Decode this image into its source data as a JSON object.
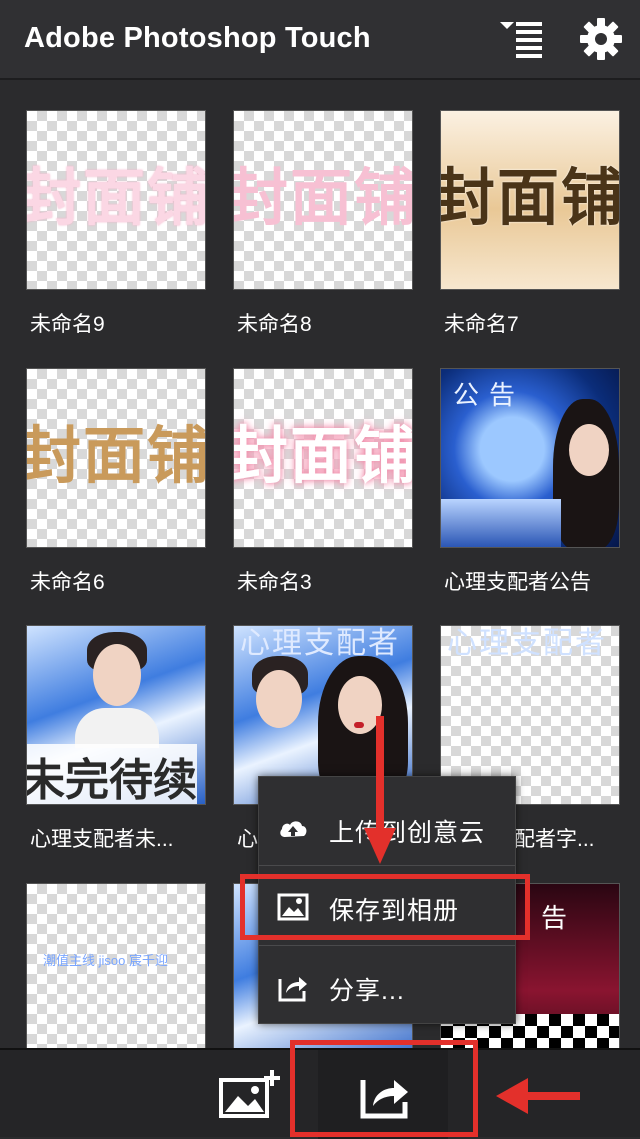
{
  "app": {
    "title": "Adobe Photoshop Touch"
  },
  "colors": {
    "accent_red": "#e3302b",
    "bar_bg": "#303033",
    "grid_bg": "#2b2b2d"
  },
  "grid": {
    "tiles": [
      {
        "label": "未命名9",
        "cover_text": "封面铺"
      },
      {
        "label": "未命名8",
        "cover_text": "封面铺"
      },
      {
        "label": "未命名7",
        "cover_text": "封面铺"
      },
      {
        "label": "未命名6",
        "cover_text": "封面铺"
      },
      {
        "label": "未命名3",
        "cover_text": "封面铺"
      },
      {
        "label": "心理支配者公告",
        "cover_text": "公告"
      },
      {
        "label": "心理支配者未...",
        "cover_text": "未完待续"
      },
      {
        "label": "心",
        "cover_text": "心理支配者"
      },
      {
        "label": "配者字...",
        "cover_text": "心理支配者"
      },
      {
        "label": "",
        "cover_text": "潮值主线 jisoo 宸千迎"
      },
      {
        "label": "",
        "cover_text": ""
      },
      {
        "label": "",
        "cover_text": "告"
      }
    ]
  },
  "popup_menu": {
    "items": [
      {
        "label": "上传到创意云",
        "icon": "cloud-upload-icon"
      },
      {
        "label": "保存到相册",
        "icon": "image-icon"
      },
      {
        "label": "分享...",
        "icon": "share-icon"
      }
    ]
  },
  "toolbar": {
    "icons": [
      "add-image-icon",
      "share-icon"
    ]
  }
}
